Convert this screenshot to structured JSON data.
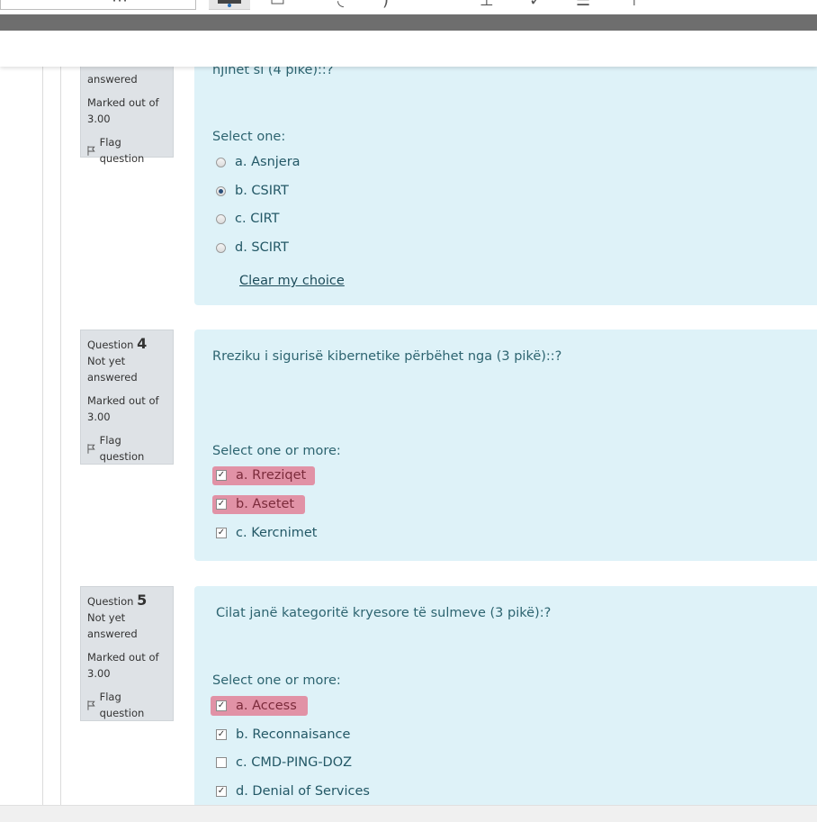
{
  "toolbar": {
    "icons": [
      "text-format-icon",
      "format-button-icon",
      "undo-icon",
      "text-tool-icon",
      "checkmark-tool-icon",
      "list-tool-icon",
      "pin-tool-icon"
    ]
  },
  "q3": {
    "status_tail": "answered",
    "marked": "Marked out of 3.00",
    "flag": "Flag question",
    "question_tail": "njihet si (4 pikë)::?",
    "select_label": "Select one:",
    "options": [
      {
        "label": "a. Asnjera",
        "checked": false
      },
      {
        "label": "b. CSIRT",
        "checked": true
      },
      {
        "label": "c. CIRT",
        "checked": false
      },
      {
        "label": "d. SCIRT",
        "checked": false
      }
    ],
    "clear": "Clear my choice"
  },
  "q4": {
    "question_word": "Question",
    "number": "4",
    "status": "Not yet answered",
    "marked": "Marked out of 3.00",
    "flag": "Flag question",
    "question": "Rreziku i sigurisë kibernetike përbëhet nga (3 pikë)::?",
    "select_label": "Select one or more:",
    "options": [
      {
        "label": "a. Rreziqet",
        "checked": true,
        "highlight": true
      },
      {
        "label": "b. Asetet",
        "checked": true,
        "highlight": true
      },
      {
        "label": "c. Kercnimet",
        "checked": true,
        "highlight": false
      }
    ]
  },
  "q5": {
    "question_word": "Question",
    "number": "5",
    "status": "Not yet answered",
    "marked": "Marked out of 3.00",
    "flag": "Flag question",
    "question": "Cilat janë kategoritë kryesore të sulmeve (3 pikë):?",
    "select_label": "Select one or more:",
    "options": [
      {
        "label": "a. Access",
        "checked": true,
        "highlight": true
      },
      {
        "label": "b. Reconnaisance",
        "checked": true,
        "highlight": false
      },
      {
        "label": "c. CMD-PING-DOZ",
        "checked": false,
        "highlight": false
      },
      {
        "label": "d. Denial of Services",
        "checked": true,
        "highlight": false
      }
    ]
  },
  "colors": {
    "question_bg": "#def2f8",
    "info_bg": "#dee2e6",
    "highlight": "#e26c86",
    "text": "#2d6470"
  }
}
